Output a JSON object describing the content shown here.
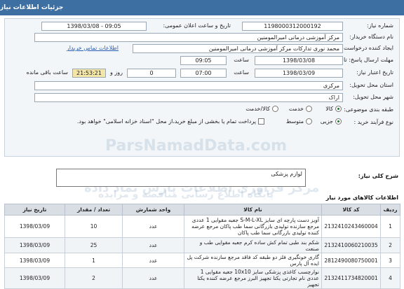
{
  "header": {
    "title": "جزئیات اطلاعات نیاز"
  },
  "form": {
    "need_number_label": "شماره نیاز:",
    "need_number": "1198000312000192",
    "announce_label": "تاریخ و ساعت اعلان عمومی:",
    "announce_value": "1398/03/08 - 09:05",
    "buyer_label": "نام دستگاه خریدار:",
    "buyer_value": "مرکز آموزشی درمانی امیرالمومنین",
    "creator_label": "ایجاد کننده درخواست:",
    "creator_value": "محمد نوری تدارکات مرکز آموزشی درمانی امیرالمومنین",
    "contact_link": "اطلاعات تماس خریدار",
    "deadline_label": "مهلت ارسال پاسخ: تا تاریخ:",
    "deadline_date": "1398/03/08",
    "time_label": "ساعت",
    "deadline_time": "09:05",
    "validity_label": "تاریخ اعتبار نیاز:",
    "validity_date": "1398/03/09",
    "validity_time": "07:00",
    "days_value": "0",
    "days_label": "روز و",
    "remaining_time": "21:53:21",
    "remaining_label": "ساعت باقی مانده",
    "province_label": "استان محل تحویل:",
    "province_value": "مرکزی",
    "city_label": "شهر محل تحویل:",
    "city_value": "اراک",
    "category_label": "طبقه بندی موضوعی:",
    "category_options": [
      "کالا",
      "خدمت",
      "کالا/خدمت"
    ],
    "purchase_type_label": "نوع فرآیند خرید :",
    "purchase_options": [
      "جزیی",
      "متوسط"
    ],
    "payment_note": "پرداخت تمام یا بخشی از مبلغ خرید،از محل \"اسناد خزانه اسلامی\" خواهد بود."
  },
  "need_section": {
    "label": "شرح کلی نیاز:",
    "value": "لوازم پزشکی"
  },
  "watermarks": {
    "wm1": "ParsNamadData.com",
    "wm2": "مرکز فراوری اطلاعات پارس نماد داده",
    "wm3": "پایگاه اطلاع رسانی مناقصه و مزایده"
  },
  "goods_section": {
    "title": "اطلاعات کالاهای مورد نیاز"
  },
  "goods_table": {
    "headers": [
      "ردیف",
      "کد کالا",
      "نام کالا",
      "واحد شمارش",
      "تعداد / مقدار",
      "تاریخ نیاز"
    ],
    "rows": [
      [
        "1",
        "2132410243460004",
        "آویز دست پارچه ای سایز S-M-L-XL جعبه مقوایی 1 عددی مرجع سازنده تولیدی بازرگانی سما طب پاکان مرجع عرضه کننده تولیدی بازرگانی سما طب پاکان",
        "عدد",
        "10",
        "1398/03/09"
      ],
      [
        "2",
        "2132410060210035",
        "شکم بند طبی تمام کش ساده کرم جعبه مقوایی طب و صنعت",
        "عدد",
        "25",
        "1398/03/09"
      ],
      [
        "3",
        "2812490080750001",
        "گاری خونگیری فلز دو طبقه کد فاقد مرجع سازنده شرکت پل ایده آل پارس",
        "عدد",
        "1",
        "1398/03/09"
      ],
      [
        "4",
        "2132411734820001",
        "نوارچسب کاغذی پزشکی سایز 10x10 جعبه مقوایی 1 عددی نام تجارتی یکتا تجهیز البرز مرجع عرضه کننده یکتا تجهیز",
        "عدد",
        "2",
        "1398/03/09"
      ]
    ]
  }
}
